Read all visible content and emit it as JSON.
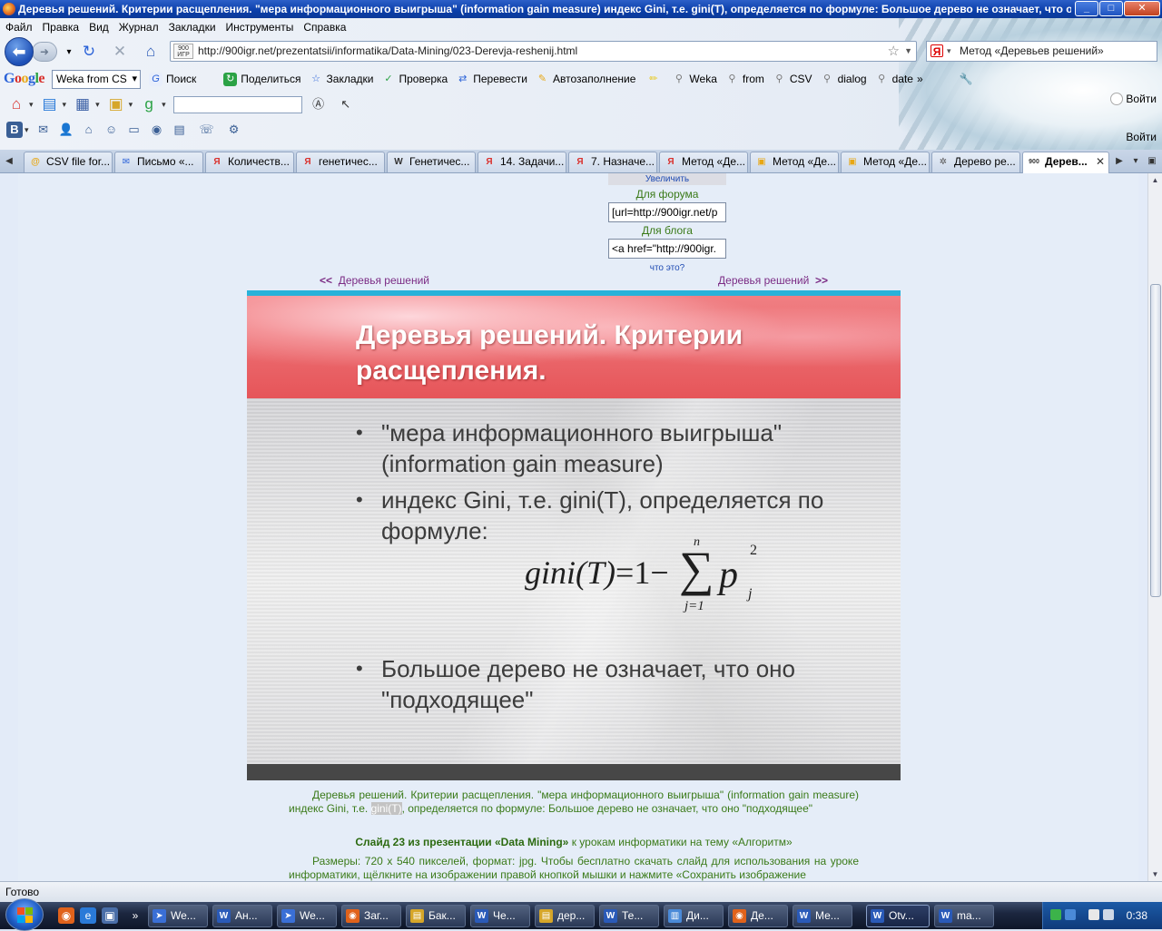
{
  "window": {
    "title": "Деревья решений. Критерии расщепления. \"мера информационного выигрыша\" (information gain measure) индекс Gini, т.е. gini(T), определяется по формуле: Большое дерево не означает, что оно \"подходя...",
    "min": "_",
    "max": "□",
    "close": "✕"
  },
  "menu": [
    "Файл",
    "Правка",
    "Вид",
    "Журнал",
    "Закладки",
    "Инструменты",
    "Справка"
  ],
  "nav": {
    "url": "http://900igr.net/prezentatsii/informatika/Data-Mining/023-Derevja-reshenij.html",
    "favicon_text": "900 ИГР",
    "search_text": "Метод «Деревьев решений»"
  },
  "google_toolbar": {
    "logo": [
      "G",
      "o",
      "o",
      "g",
      "l",
      "e"
    ],
    "select_value": "Weka from CS",
    "items": [
      "Поиск",
      "Поделиться",
      "Закладки",
      "Проверка",
      "Перевести",
      "Автозаполнение",
      "Weka",
      "from",
      "CSV",
      "dialog",
      "date"
    ],
    "more": "»",
    "signin": "Войти"
  },
  "tabs": [
    {
      "label": "CSV file for...",
      "icon": "@",
      "color": "#e8a714"
    },
    {
      "label": "Письмо «...",
      "icon": "✉",
      "color": "#2a62d8"
    },
    {
      "label": "Количеств...",
      "icon": "Я",
      "color": "#d9302c"
    },
    {
      "label": "генетичес...",
      "icon": "Я",
      "color": "#d9302c"
    },
    {
      "label": "Генетичес...",
      "icon": "W",
      "color": "#333333"
    },
    {
      "label": "14. Задачи...",
      "icon": "Я",
      "color": "#d9302c"
    },
    {
      "label": "7. Назначе...",
      "icon": "Я",
      "color": "#d9302c"
    },
    {
      "label": "Метод «Де...",
      "icon": "Я",
      "color": "#d9302c"
    },
    {
      "label": "Метод «Де...",
      "icon": "▣",
      "color": "#e8a714"
    },
    {
      "label": "Метод «Де...",
      "icon": "▣",
      "color": "#e8a714"
    },
    {
      "label": "Дерево ре...",
      "icon": "✲",
      "color": "#555555"
    },
    {
      "label": "Дерев...",
      "icon": "900",
      "color": "#333333",
      "active": true
    }
  ],
  "share": {
    "enlarge": "Увеличить",
    "forum_label": "Для форума",
    "forum_value": "[url=http://900igr.net/p",
    "blog_label": "Для блога",
    "blog_value": "<a href=\"http://900igr.",
    "what": "что это?"
  },
  "pager": {
    "prev_arrow": "<<",
    "prev_label": "Деревья решений",
    "next_label": "Деревья решений",
    "next_arrow": ">>"
  },
  "slide": {
    "title_line1": "Деревья решений. Критерии",
    "title_line2": "расщепления.",
    "bullet1_line1": "\"мера информационного выигрыша\"",
    "bullet1_line2": "(information gain measure)",
    "bullet2_line1": "индекс Gini, т.е. gini(T), определяется по",
    "bullet2_line2": "формуле:",
    "bullet3_line1": "Большое дерево не означает, что оно",
    "bullet3_line2": "\"подходящее\"",
    "formula": {
      "lhs": "gini(T)",
      "eq": "=1−",
      "sigma": "∑",
      "upper": "n",
      "lower": "j=1",
      "p": "p",
      "power": "2",
      "sub": "j"
    }
  },
  "caption": {
    "part1": "Деревья решений. Критерии расщепления. \"мера информационного выигрыша\" (information gain measure) индекс Gini, т.е. ",
    "highlight": "gini(T)",
    "part2": ", определяется по формуле: Большое дерево не означает, что оно \"подходящее\""
  },
  "slide_info": {
    "lead": "Слайд 23 из презентации «Data Mining»",
    "rest": " к урокам информатики на тему «Алгоритм»"
  },
  "sizes_text": "Размеры: 720 x 540 пикселей, формат: jpg. Чтобы бесплатно скачать слайд для использования на уроке информатики, щёлкните на изображении правой кнопкой мышки и нажмите «Сохранить изображение",
  "status": "Готово",
  "taskbar": {
    "items": [
      {
        "label": "We...",
        "icon": "➤",
        "color": "#3a6fd6"
      },
      {
        "label": "Ан...",
        "icon": "W",
        "color": "#2a5ab8"
      },
      {
        "label": "We...",
        "icon": "➤",
        "color": "#3a6fd6"
      },
      {
        "label": "Заг...",
        "icon": "◉",
        "color": "#e0621b"
      },
      {
        "label": "Бак...",
        "icon": "▤",
        "color": "#d6a629"
      },
      {
        "label": "Че...",
        "icon": "W",
        "color": "#2a5ab8"
      },
      {
        "label": "дер...",
        "icon": "▤",
        "color": "#d6a629"
      },
      {
        "label": "Те...",
        "icon": "W",
        "color": "#2a5ab8"
      },
      {
        "label": "Ди...",
        "icon": "▥",
        "color": "#4a8ad8"
      },
      {
        "label": "Де...",
        "icon": "◉",
        "color": "#e0621b"
      },
      {
        "label": "Ме...",
        "icon": "W",
        "color": "#2a5ab8"
      },
      {
        "label": "Otv...",
        "icon": "W",
        "color": "#2a5ab8",
        "active": true
      },
      {
        "label": "ma...",
        "icon": "W",
        "color": "#2a5ab8"
      }
    ],
    "clock": "0:38"
  }
}
